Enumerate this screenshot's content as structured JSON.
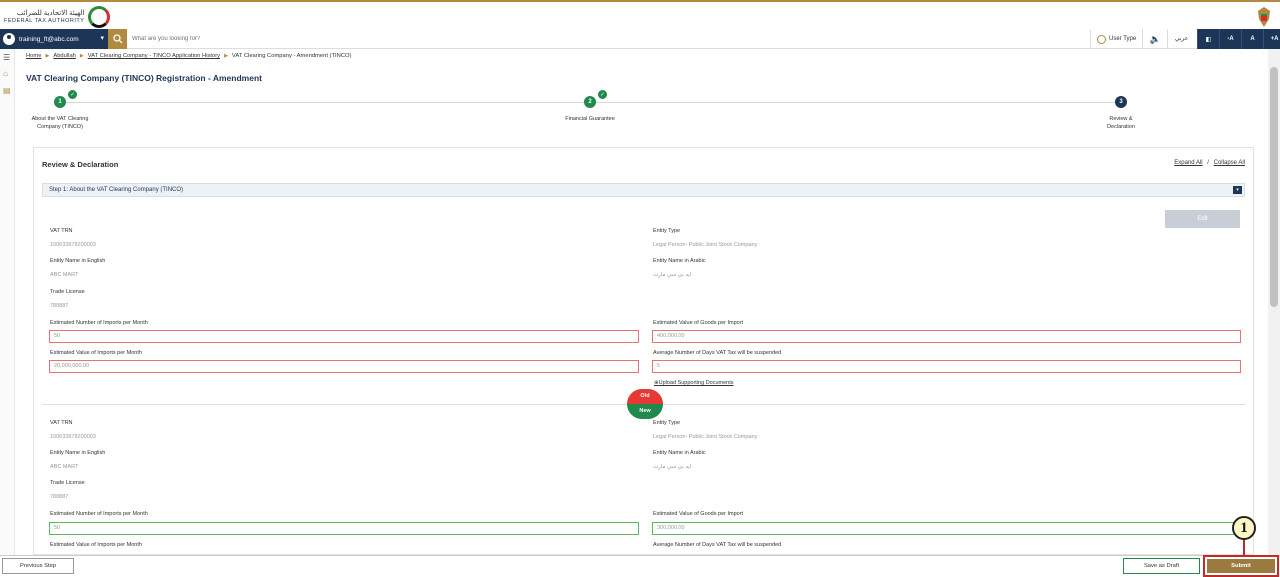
{
  "header": {
    "logo_arabic": "الهيئة الاتحادية للضرائب",
    "logo_english": "FEDERAL TAX AUTHORITY"
  },
  "searchbar": {
    "user_email": "training_ft@abc.com",
    "search_placeholder": "What are you looking for?",
    "user_type_label": "User Type",
    "arabic_label": "عربي",
    "tools": [
      "-A",
      "A",
      "+A"
    ]
  },
  "breadcrumb": {
    "items": [
      "Home",
      "Abdullah",
      "VAT Clearing Company - TINCO Application History",
      "VAT Clearing Company - Amendment (TINCO)"
    ]
  },
  "page": {
    "title": "VAT Clearing Company (TINCO) Registration - Amendment"
  },
  "stepper": {
    "steps": [
      {
        "number": "1",
        "label": "About the VAT Clearing Company (TINCO)",
        "status": "done"
      },
      {
        "number": "2",
        "label": "Financial Guarantee",
        "status": "done"
      },
      {
        "number": "3",
        "label": "Review & Declaration",
        "status": "active"
      }
    ]
  },
  "review": {
    "title": "Review & Declaration",
    "expand_all": "Expand All",
    "separator": "/",
    "collapse_all": "Collapse All",
    "section_title": "Step 1: About the VAT Clearing Company (TINCO)",
    "edit_label": "Edit",
    "upload_label": "Upload Supporting Documents",
    "old_label": "Old",
    "new_label": "New",
    "old": {
      "vat_trn_label": "VAT TRN",
      "vat_trn": "100633878200003",
      "entity_type_label": "Entity Type",
      "entity_type": "Legal Person- Public Joint Stock Company",
      "name_en_label": "Entity Name in English",
      "name_en": "ABC MART",
      "name_ar_label": "Entity Name in Arabic",
      "name_ar": "ايه بي سي مارت",
      "trade_license_label": "Trade License",
      "trade_license": "788887",
      "imports_label": "Estimated Number of Imports per Month",
      "imports": "50",
      "goods_value_label": "Estimated Value of Goods per Import",
      "goods_value": "400,000.00",
      "imports_value_label": "Estimated Value of Imports per Month",
      "imports_value": "20,000,000.00",
      "days_label": "Average Number of Days VAT Tax will be suspended",
      "days": "5"
    },
    "new": {
      "vat_trn_label": "VAT TRN",
      "vat_trn": "100633878200003",
      "entity_type_label": "Entity Type",
      "entity_type": "Legal Person- Public Joint Stock Company",
      "name_en_label": "Entity Name in English",
      "name_en": "ABC MART",
      "name_ar_label": "Entity Name in Arabic",
      "name_ar": "ايه بي سي مارت",
      "trade_license_label": "Trade License",
      "trade_license": "788887",
      "imports_label": "Estimated Number of Imports per Month",
      "imports": "50",
      "goods_value_label": "Estimated Value of Goods per Import",
      "goods_value": "300,000.00",
      "imports_value_label": "Estimated Value of Imports per Month",
      "days_label": "Average Number of Days VAT Tax will be suspended"
    }
  },
  "footer": {
    "previous_step": "Previous Step",
    "save_draft": "Save as Draft",
    "submit": "Submit"
  },
  "callout": {
    "number": "1"
  },
  "colors": {
    "navy": "#1d3557",
    "gold": "#b08a3e",
    "green": "#1f8a4c",
    "red": "#c62828"
  }
}
